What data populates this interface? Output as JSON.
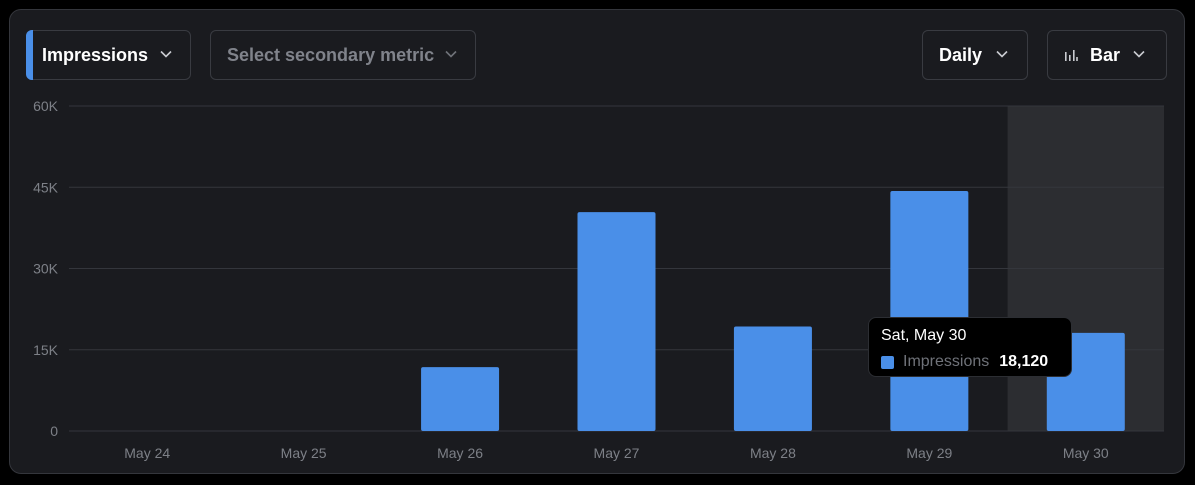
{
  "controls": {
    "primary_metric": "Impressions",
    "secondary_metric_placeholder": "Select secondary metric",
    "period": "Daily",
    "chart_type": "Bar",
    "chart_type_icon": "bar-chart-icon"
  },
  "colors": {
    "bar": "#4a8fe8",
    "panel_bg": "#1a1b1f",
    "highlight_bg": "#2c2d31",
    "grid": "#34363c",
    "axis_text": "#7d8087"
  },
  "chart_data": {
    "type": "bar",
    "categories": [
      "May 24",
      "May 25",
      "May 26",
      "May 27",
      "May 28",
      "May 29",
      "May 30"
    ],
    "series": [
      {
        "name": "Impressions",
        "values": [
          0,
          0,
          11800,
          40400,
          19300,
          44300,
          18120
        ]
      }
    ],
    "ylim": [
      0,
      60000
    ],
    "yticks": [
      0,
      15000,
      30000,
      45000,
      60000
    ],
    "ytick_labels": [
      "0",
      "15K",
      "30K",
      "45K",
      "60K"
    ],
    "grid": true,
    "highlighted_category": "May 30",
    "tooltip": {
      "title": "Sat, May 30",
      "series_name": "Impressions",
      "value": "18,120"
    }
  }
}
